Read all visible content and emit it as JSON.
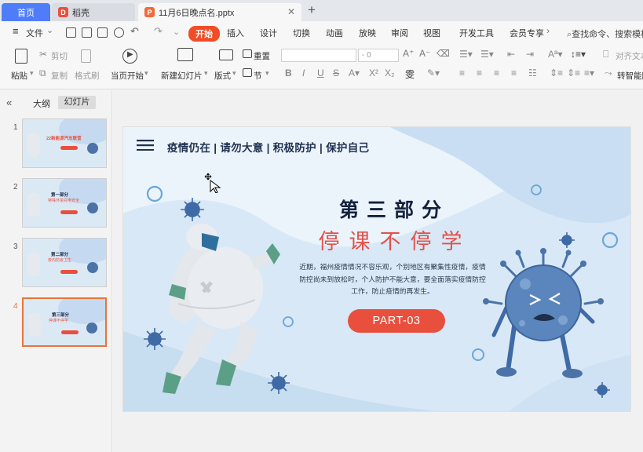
{
  "tabs": {
    "home": "首页",
    "daoke": "稻壳",
    "doc": "11月6日晚点名.pptx"
  },
  "menu": {
    "file": "文件",
    "items": [
      "开始",
      "插入",
      "设计",
      "切换",
      "动画",
      "放映",
      "审阅",
      "视图",
      "开发工具",
      "会员专享"
    ],
    "search": "查找命令、搜索模板"
  },
  "ribbon": {
    "paste": "粘贴",
    "cut": "剪切",
    "copy": "复制",
    "format_painter": "格式刷",
    "play_from_current": "当页开始",
    "new_slide": "新建幻灯片",
    "layout": "版式",
    "section": "节",
    "reset": "重置",
    "font_size": "0",
    "align_text": "对齐文本",
    "smart_shape": "转智能图形"
  },
  "panel": {
    "outline_tab": "大纲",
    "slides_tab": "幻灯片",
    "thumbnails": [
      {
        "num": "1",
        "title": "22新能源汽车联营",
        "sub": "",
        "active": false
      },
      {
        "num": "2",
        "title": "第一部分",
        "sub": "特殊环境充电安全",
        "active": false
      },
      {
        "num": "3",
        "title": "第二部分",
        "sub": "校内防疫卫生",
        "active": false
      },
      {
        "num": "4",
        "title": "第三部分",
        "sub": "停课不停学",
        "active": true
      }
    ]
  },
  "slide": {
    "title": "疫情仍在 | 请勿大意 | 积极防护 | 保护自己",
    "heading": "第三部分",
    "subheading": "停课不停学",
    "body_lines": [
      "近期，福州疫情情况不容乐观，个别地区有聚集性疫情，疫情",
      "防控尚未到放松时，个人防护不能大意，要全面落实疫情防控",
      "工作，防止疫情的再发生。"
    ],
    "button": "PART-03",
    "colors": {
      "accent_red": "#e8503d",
      "navy": "#13213d",
      "virus_blue": "#4b73a8",
      "bg_light": "#ebf3fb"
    }
  }
}
